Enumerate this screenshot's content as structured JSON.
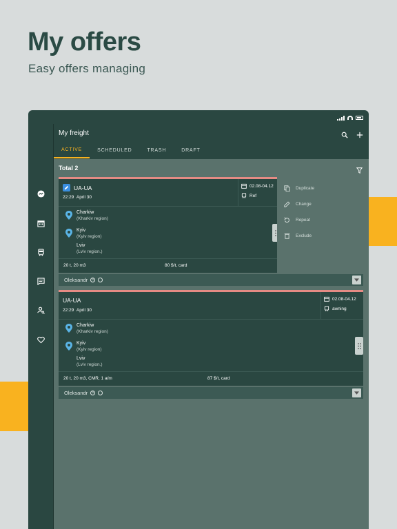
{
  "promo": {
    "title": "My offers",
    "subtitle": "Easy offers managing"
  },
  "app": {
    "title": "My freight",
    "tabs": [
      "ACTIVE",
      "SCHEDULED",
      "TRASH",
      "DRAFT"
    ],
    "active_tab": "ACTIVE"
  },
  "total": "Total 2",
  "offers": [
    {
      "route": "UA-UA",
      "time": "22:29",
      "date": "April 30",
      "dates": "02.08-04.12",
      "body": "Ref",
      "stops": [
        {
          "city": "Charkiw",
          "region": "(Kharkiv region)"
        },
        {
          "city": "Kyiv",
          "region": "(Kyiv region)"
        },
        {
          "city": "Lviv",
          "region": "(Lviv region.)"
        }
      ],
      "cargo": "20 t, 20 m3",
      "price": "80 $/t, card",
      "owner": "Oleksandr"
    },
    {
      "route": "UA-UA",
      "time": "22:29",
      "date": "April 30",
      "dates": "02.08-04.12",
      "body": "awning",
      "stops": [
        {
          "city": "Charkiw",
          "region": "(Kharkiv region)"
        },
        {
          "city": "Kyiv",
          "region": "(Kyiv region)"
        },
        {
          "city": "Lviv",
          "region": "(Lviv region.)"
        }
      ],
      "cargo": "20 t, 20 m3, CMR, 1 a/m",
      "price": "87 $/t, card",
      "owner": "Oleksandr"
    }
  ],
  "context_menu": [
    "Duplicate",
    "Change",
    "Repeat",
    "Exclude"
  ],
  "colors": {
    "accent": "#f9b21f",
    "dark": "#2a4741",
    "card_top": "#e58b84",
    "pin": "#5ab4e6"
  },
  "icons": {
    "rail": [
      "messenger-icon",
      "calendar-icon",
      "bus-icon",
      "chat-icon",
      "user-search-icon",
      "heart-icon"
    ],
    "appbar": [
      "search-icon",
      "plus-icon"
    ]
  }
}
